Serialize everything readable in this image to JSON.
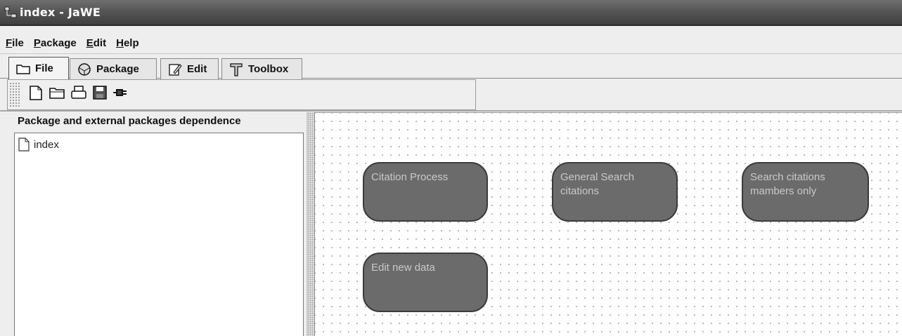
{
  "window": {
    "title": "index - JaWE",
    "icon": "jawe-app-icon"
  },
  "menubar": {
    "items": [
      {
        "label": "File",
        "mnemonic": "F"
      },
      {
        "label": "Package",
        "mnemonic": "P"
      },
      {
        "label": "Edit",
        "mnemonic": "E"
      },
      {
        "label": "Help",
        "mnemonic": "H"
      }
    ]
  },
  "tabs": [
    {
      "label": "File",
      "icon": "folder-icon",
      "active": true
    },
    {
      "label": "Package",
      "icon": "package-icon",
      "active": false
    },
    {
      "label": "Edit",
      "icon": "edit-icon",
      "active": false
    },
    {
      "label": "Toolbox",
      "icon": "toolbox-icon",
      "active": false
    }
  ],
  "toolbar": {
    "buttons": [
      "new-file-icon",
      "open-folder-icon",
      "print-icon",
      "save-icon",
      "plugin-icon"
    ]
  },
  "left_panel": {
    "title": "Package and external packages dependence",
    "tree": [
      {
        "label": "index",
        "icon": "document-icon"
      }
    ]
  },
  "canvas": {
    "processes": [
      {
        "lines": [
          "Citation Process"
        ]
      },
      {
        "lines": [
          "General Search",
          "citations"
        ]
      },
      {
        "lines": [
          "Search citations",
          "mambers only"
        ]
      },
      {
        "lines": [
          "Edit new data"
        ]
      }
    ],
    "colors": {
      "node_fill": "#6b6b6b",
      "node_border": "#3b3b3b",
      "node_text": "#c9c9c9"
    }
  }
}
